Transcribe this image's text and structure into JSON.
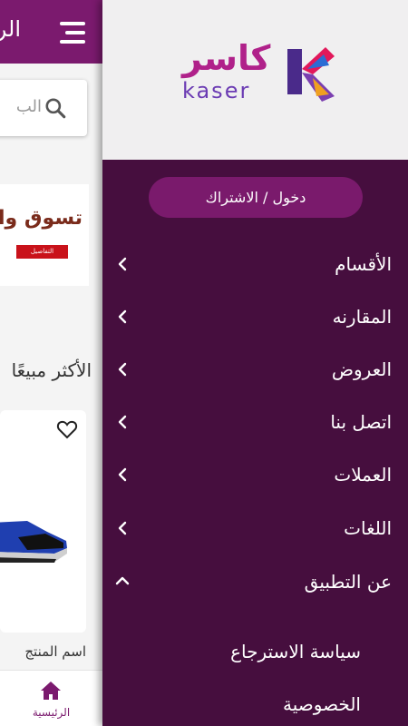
{
  "background": {
    "title": "الر",
    "search_placeholder": "الب",
    "banner_text": "تسوق وا",
    "banner_button": "التفاصيل",
    "section_title": "الأكثر مبيعًا",
    "product_name": "اسم المنتج",
    "bottom_nav": {
      "home_label": "الرئيسية"
    },
    "colors": {
      "topbar": "#7b1a6e",
      "banner_button": "#c9121a"
    }
  },
  "drawer": {
    "logo": {
      "arabic": "كاسر",
      "latin": "kaser"
    },
    "login_button": "دخول / الاشتراك",
    "menu": [
      {
        "label": "الأقسام",
        "icon": "chevron-left-icon"
      },
      {
        "label": "المقارنه",
        "icon": "chevron-left-icon"
      },
      {
        "label": "العروض",
        "icon": "chevron-left-icon"
      },
      {
        "label": "اتصل بنا",
        "icon": "chevron-left-icon"
      },
      {
        "label": "العملات",
        "icon": "chevron-left-icon"
      },
      {
        "label": "اللغات",
        "icon": "chevron-left-icon"
      },
      {
        "label": "عن التطبيق",
        "icon": "chevron-up-icon",
        "expanded": true
      }
    ],
    "about_submenu": [
      {
        "label": "سياسة الاسترجاع"
      },
      {
        "label": "الخصوصية"
      }
    ],
    "colors": {
      "background": "#460e3e",
      "header": "#f0eff0",
      "button": "#7a1a6c"
    }
  }
}
